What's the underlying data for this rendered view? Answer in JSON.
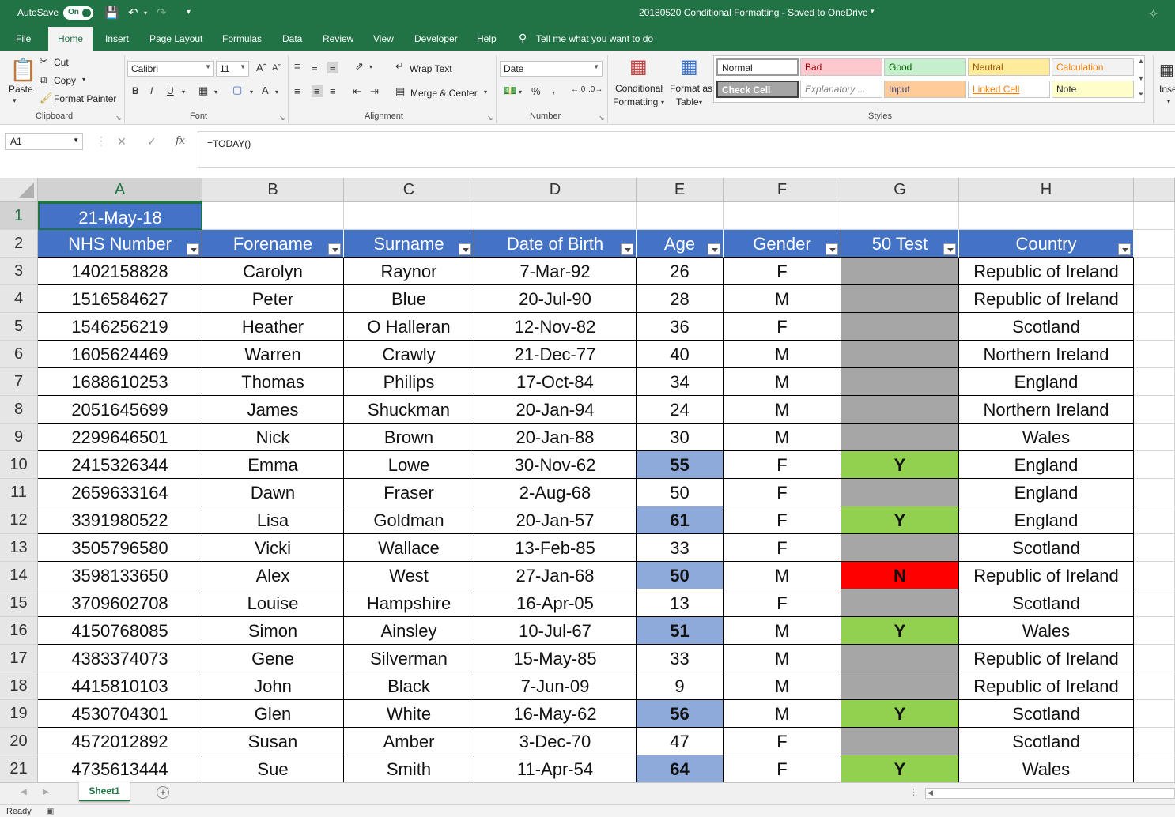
{
  "titlebar": {
    "autosave_label": "AutoSave",
    "autosave_state": "On",
    "doc_title": "20180520 Conditional Formatting  -  Saved to OneDrive",
    "color": "#217346"
  },
  "menu": {
    "tabs": [
      "File",
      "Home",
      "Insert",
      "Page Layout",
      "Formulas",
      "Data",
      "Review",
      "View",
      "Developer",
      "Help"
    ],
    "active": "Home",
    "tell_me": "Tell me what you want to do"
  },
  "ribbon": {
    "clipboard": {
      "paste": "Paste",
      "cut": "Cut",
      "copy": "Copy",
      "format_painter": "Format Painter",
      "label": "Clipboard"
    },
    "font": {
      "name": "Calibri",
      "size": "11",
      "bold": "B",
      "italic": "I",
      "underline": "U",
      "label": "Font"
    },
    "alignment": {
      "wrap_text": "Wrap Text",
      "merge_center": "Merge & Center",
      "label": "Alignment"
    },
    "number": {
      "format": "Date",
      "percent": "%",
      "comma": ",",
      "label": "Number"
    },
    "styles": {
      "conditional_formatting_1": "Conditional",
      "conditional_formatting_2": "Formatting",
      "format_as_table_1": "Format as",
      "format_as_table_2": "Table",
      "label": "Styles",
      "cells": [
        {
          "label": "Normal",
          "bg": "#ffffff",
          "fg": "#222222"
        },
        {
          "label": "Bad",
          "bg": "#ffc7ce",
          "fg": "#9c0006"
        },
        {
          "label": "Good",
          "bg": "#c6efce",
          "fg": "#006100"
        },
        {
          "label": "Neutral",
          "bg": "#ffeb9c",
          "fg": "#9c5700"
        },
        {
          "label": "Calculation",
          "bg": "#f2f2f2",
          "fg": "#fa7d00"
        },
        {
          "label": "Check Cell",
          "bg": "#a5a5a5",
          "fg": "#ffffff"
        },
        {
          "label": "Explanatory ...",
          "bg": "#ffffff",
          "fg": "#7f7f7f"
        },
        {
          "label": "Input",
          "bg": "#ffcc99",
          "fg": "#3f3f76"
        },
        {
          "label": "Linked Cell",
          "bg": "#ffffff",
          "fg": "#fa7d00"
        },
        {
          "label": "Note",
          "bg": "#ffffcc",
          "fg": "#222222"
        }
      ]
    },
    "insert_label": "Inse"
  },
  "formula_bar": {
    "name_box": "A1",
    "formula": "=TODAY()",
    "fx": "fx"
  },
  "grid": {
    "columns": [
      "A",
      "B",
      "C",
      "D",
      "E",
      "F",
      "G",
      "H"
    ],
    "date_cell": "21-May-18",
    "headers": [
      "NHS Number",
      "Forename",
      "Surname",
      "Date of Birth",
      "Age",
      "Gender",
      "50 Test",
      "Country"
    ],
    "rows": [
      {
        "row": "3",
        "nhs": "1402158828",
        "forename": "Carolyn",
        "surname": "Raynor",
        "dob": "7-Mar-92",
        "age": "26",
        "gender": "F",
        "test": "",
        "country": "Republic of Ireland"
      },
      {
        "row": "4",
        "nhs": "1516584627",
        "forename": "Peter",
        "surname": "Blue",
        "dob": "20-Jul-90",
        "age": "28",
        "gender": "M",
        "test": "",
        "country": "Republic of Ireland"
      },
      {
        "row": "5",
        "nhs": "1546256219",
        "forename": "Heather",
        "surname": "O Halleran",
        "dob": "12-Nov-82",
        "age": "36",
        "gender": "F",
        "test": "",
        "country": "Scotland"
      },
      {
        "row": "6",
        "nhs": "1605624469",
        "forename": "Warren",
        "surname": "Crawly",
        "dob": "21-Dec-77",
        "age": "40",
        "gender": "M",
        "test": "",
        "country": "Northern Ireland"
      },
      {
        "row": "7",
        "nhs": "1688610253",
        "forename": "Thomas",
        "surname": "Philips",
        "dob": "17-Oct-84",
        "age": "34",
        "gender": "M",
        "test": "",
        "country": "England"
      },
      {
        "row": "8",
        "nhs": "2051645699",
        "forename": "James",
        "surname": "Shuckman",
        "dob": "20-Jan-94",
        "age": "24",
        "gender": "M",
        "test": "",
        "country": "Northern Ireland"
      },
      {
        "row": "9",
        "nhs": "2299646501",
        "forename": "Nick",
        "surname": "Brown",
        "dob": "20-Jan-88",
        "age": "30",
        "gender": "M",
        "test": "",
        "country": "Wales"
      },
      {
        "row": "10",
        "nhs": "2415326344",
        "forename": "Emma",
        "surname": "Lowe",
        "dob": "30-Nov-62",
        "age": "55",
        "gender": "F",
        "test": "Y",
        "country": "England"
      },
      {
        "row": "11",
        "nhs": "2659633164",
        "forename": "Dawn",
        "surname": "Fraser",
        "dob": "2-Aug-68",
        "age": "50",
        "gender": "F",
        "test": "",
        "country": "England"
      },
      {
        "row": "12",
        "nhs": "3391980522",
        "forename": "Lisa",
        "surname": "Goldman",
        "dob": "20-Jan-57",
        "age": "61",
        "gender": "F",
        "test": "Y",
        "country": "England"
      },
      {
        "row": "13",
        "nhs": "3505796580",
        "forename": "Vicki",
        "surname": "Wallace",
        "dob": "13-Feb-85",
        "age": "33",
        "gender": "F",
        "test": "",
        "country": "Scotland"
      },
      {
        "row": "14",
        "nhs": "3598133650",
        "forename": "Alex",
        "surname": "West",
        "dob": "27-Jan-68",
        "age": "50",
        "gender": "M",
        "test": "N",
        "country": "Republic of Ireland"
      },
      {
        "row": "15",
        "nhs": "3709602708",
        "forename": "Louise",
        "surname": "Hampshire",
        "dob": "16-Apr-05",
        "age": "13",
        "gender": "F",
        "test": "",
        "country": "Scotland"
      },
      {
        "row": "16",
        "nhs": "4150768085",
        "forename": "Simon",
        "surname": "Ainsley",
        "dob": "10-Jul-67",
        "age": "51",
        "gender": "M",
        "test": "Y",
        "country": "Wales"
      },
      {
        "row": "17",
        "nhs": "4383374073",
        "forename": "Gene",
        "surname": "Silverman",
        "dob": "15-May-85",
        "age": "33",
        "gender": "M",
        "test": "",
        "country": "Republic of Ireland"
      },
      {
        "row": "18",
        "nhs": "4415810103",
        "forename": "John",
        "surname": "Black",
        "dob": "7-Jun-09",
        "age": "9",
        "gender": "M",
        "test": "",
        "country": "Republic of Ireland"
      },
      {
        "row": "19",
        "nhs": "4530704301",
        "forename": "Glen",
        "surname": "White",
        "dob": "16-May-62",
        "age": "56",
        "gender": "M",
        "test": "Y",
        "country": "Scotland"
      },
      {
        "row": "20",
        "nhs": "4572012892",
        "forename": "Susan",
        "surname": "Amber",
        "dob": "3-Dec-70",
        "age": "47",
        "gender": "F",
        "test": "",
        "country": "Scotland"
      },
      {
        "row": "21",
        "nhs": "4735613444",
        "forename": "Sue",
        "surname": "Smith",
        "dob": "11-Apr-54",
        "age": "64",
        "gender": "F",
        "test": "Y",
        "country": "Wales"
      }
    ],
    "colors": {
      "header_bg": "#4472c4",
      "age_highlight": "#8eaadb",
      "test_blank": "#a6a6a6",
      "test_yes": "#92d050",
      "test_no": "#ff0000"
    }
  },
  "sheets": {
    "tabs": [
      "Sheet1"
    ],
    "active": "Sheet1"
  },
  "status": {
    "text": "Ready"
  }
}
